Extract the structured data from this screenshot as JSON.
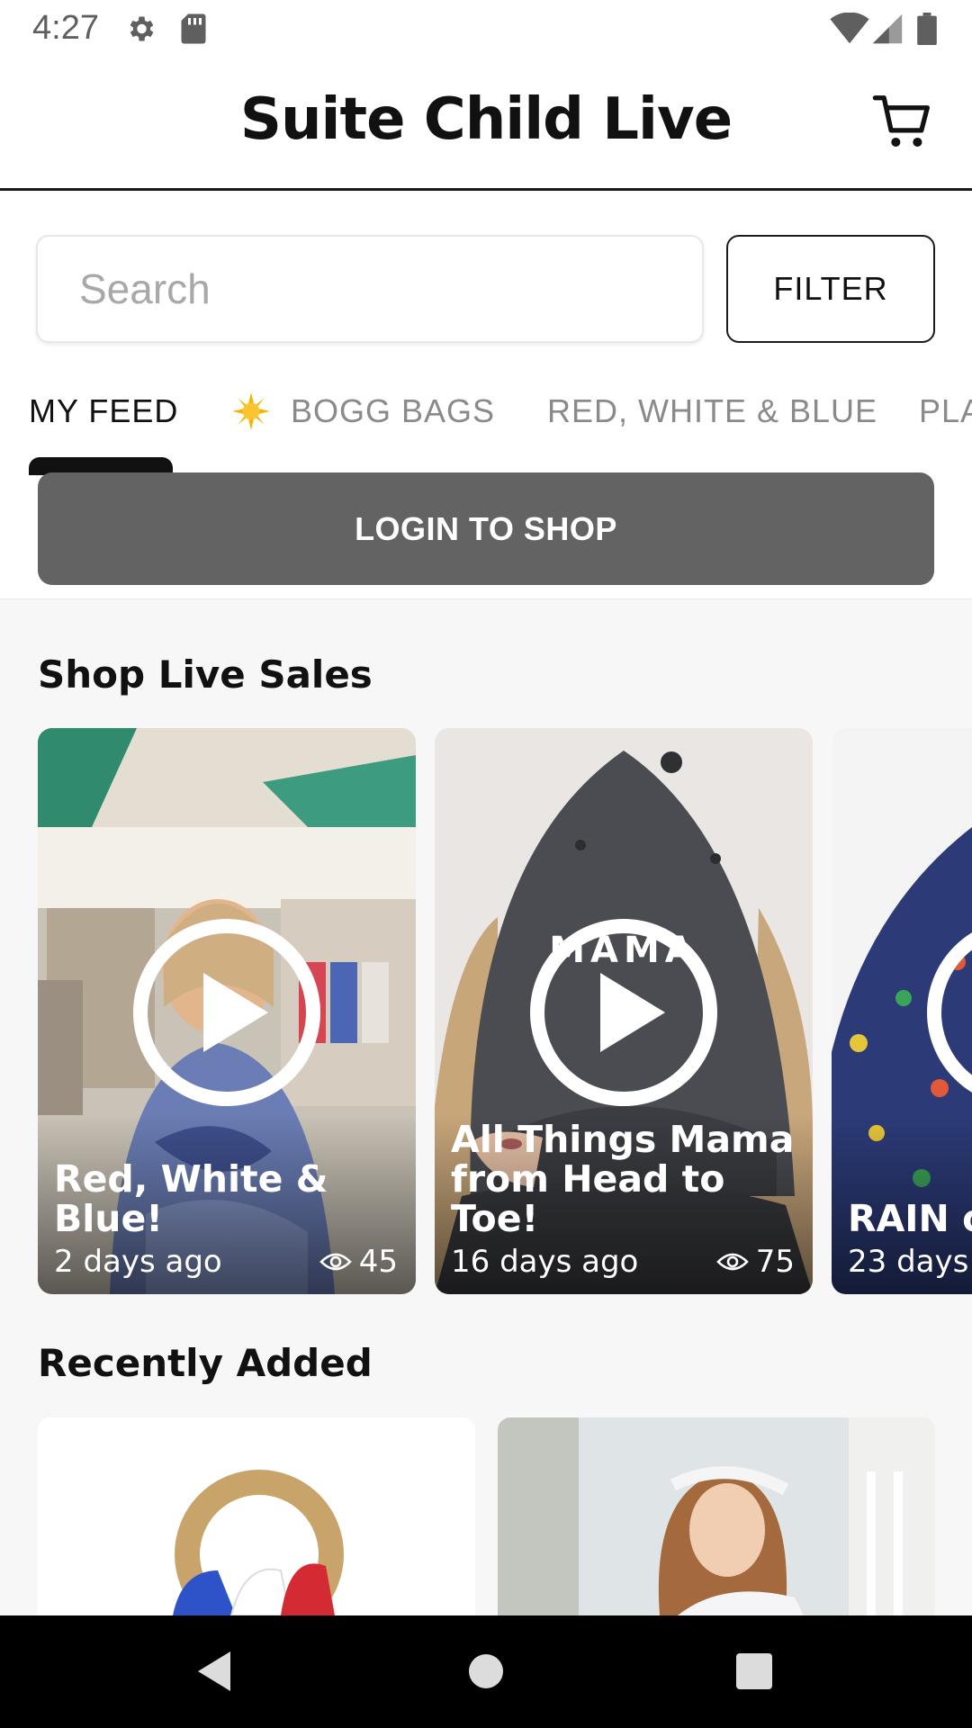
{
  "status_bar": {
    "time": "4:27",
    "icons": [
      "gear-icon",
      "sd-card-icon",
      "wifi-icon",
      "signal-icon",
      "battery-icon"
    ]
  },
  "header": {
    "title": "Suite Child Live",
    "cart_icon": "cart-icon"
  },
  "search": {
    "placeholder": "Search",
    "value": "",
    "filter_label": "FILTER"
  },
  "tabs": [
    {
      "label": "MY FEED",
      "active": true
    },
    {
      "label": "BOGG BAGS",
      "icon": "sun-icon",
      "active": false
    },
    {
      "label": "RED, WHITE & BLUE",
      "active": false
    },
    {
      "label": "PLA",
      "active": false
    }
  ],
  "login": {
    "label": "LOGIN TO SHOP"
  },
  "live_sales": {
    "title": "Shop Live Sales",
    "cards": [
      {
        "title": "Red, White & Blue!",
        "time": "2 days ago",
        "views": "45"
      },
      {
        "title": "All Things Mama from Head to Toe!",
        "time": "16 days ago",
        "views": "75"
      },
      {
        "title": "RAIN o",
        "time": "23 days",
        "views": ""
      }
    ]
  },
  "recently_added": {
    "title": "Recently Added"
  },
  "hat_text": "MAMA",
  "colors": {
    "login_bg": "#636363",
    "feed_bg": "#f7f7f8",
    "nav_bg": "#000000"
  }
}
